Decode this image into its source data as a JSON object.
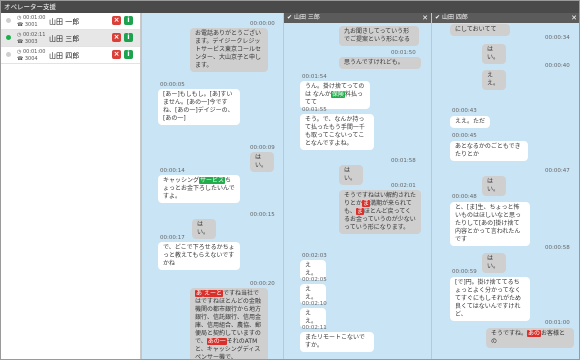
{
  "app": {
    "title": "オペレーター支援"
  },
  "operators": [
    {
      "time": "00:01:00",
      "id": "3001",
      "name": "山田 一郎",
      "status": "idle"
    },
    {
      "time": "00:02:11",
      "id": "3003",
      "name": "山田 三郎",
      "status": "active"
    },
    {
      "time": "00:01:00",
      "id": "3004",
      "name": "山田 四郎",
      "status": "idle"
    }
  ],
  "icons": {
    "close": "×",
    "info": "i",
    "pin": "✔",
    "panel_close": "✕"
  },
  "colors": {
    "highlight_green": "#21ad4b",
    "highlight_red": "#d9302b",
    "chat_bg": "#c9e4f5"
  },
  "panels": [
    {
      "name": "",
      "messages": [
        {
          "time": "00:00:00",
          "text": "お電話ありがとうございます。デイジークレジットサービス東京コールセンター、大山京子と申します。"
        },
        {
          "time": "00:00:05",
          "text": "[あー]もしもし。[あ]すいません。[あの一]今ですね、[あの一]デイジーの、[あの一]"
        },
        {
          "time": "00:00:09",
          "text": "はい。"
        },
        {
          "time": "00:00:14",
          "text_before": "キャッシング",
          "highlight": "サービス",
          "text_after": "ちょっとお金下ろしたいんですよ。"
        },
        {
          "time": "00:00:15",
          "text": "はい。"
        },
        {
          "time": "00:00:17",
          "text": "で、どこで下ろせるかちょっと教えてもらえないですかね"
        },
        {
          "time": "00:00:20",
          "highlight": "あ",
          "highlight2": "えーと",
          "text_after": "ですね当社ではですねほとんどの金融機関の都市銀行から地方銀行、信託銀行、信用金庫、信用組合、農協、郵便局と契約していますので、",
          "highlight3": "あの一",
          "text_tail": "それのATMと、キャッシングディスペンサー機で、"
        }
      ]
    },
    {
      "name": "山田 三郎",
      "messages": [
        {
          "time": "",
          "text": "九お聞きしてっていう形でご提案という形になる"
        },
        {
          "time": "00:01:50",
          "text": "思うんですけれども。"
        },
        {
          "time": "00:01:54",
          "text_before": "うん。掛け捨てってのは なんか",
          "highlight": "保険",
          "text_after": "料払ってて"
        },
        {
          "time": "00:01:55",
          "text": "そう。で、なんか持って払ったもう手間一千も取ってこないってことなんですよね。"
        },
        {
          "time": "00:01:58",
          "text": "はい。"
        },
        {
          "time": "00:02:01",
          "text": "そうですねはい解約されたりとか",
          "highlight": "ま",
          "text_after": "満期が来られても、",
          "highlight2": "ま",
          "text_tail": "ほとんど戻ってくるお金っていうのが少ないっていう形になります。"
        },
        {
          "time": "00:02:03",
          "text": "ええ。"
        },
        {
          "time": "00:02:05",
          "text": "ええ。"
        },
        {
          "time": "00:02:10",
          "text": "ええ。"
        },
        {
          "time": "00:02:11",
          "text": "またリモートこないですか。"
        }
      ]
    },
    {
      "name": "山田 四郎",
      "messages": [
        {
          "time": "",
          "text": "にしておいてて"
        },
        {
          "time": "00:00:34",
          "text": "はい。"
        },
        {
          "time": "00:00:40",
          "text": "ええ。"
        },
        {
          "time": "00:00:43",
          "text": "ええ。ただ"
        },
        {
          "time": "00:00:45",
          "text": "あとなるかのごともできたりとか"
        },
        {
          "time": "00:00:47",
          "text": "はい。"
        },
        {
          "time": "00:00:48",
          "text": "と、[ま]生、ちょっと怖いものはほしいなと思ったりして[あの]掛け捨て内容とかって言われたんです"
        },
        {
          "time": "00:00:58",
          "text": "はい。"
        },
        {
          "time": "00:00:59",
          "text": "[で]円。掛け捨ててるちょっとよく分かってなくてすぐにもしそれがため良くてはないんですけれど、"
        },
        {
          "time": "00:01:00",
          "text": "そうですね。",
          "highlight": "あの",
          "text_after": "お客様との"
        }
      ]
    }
  ]
}
